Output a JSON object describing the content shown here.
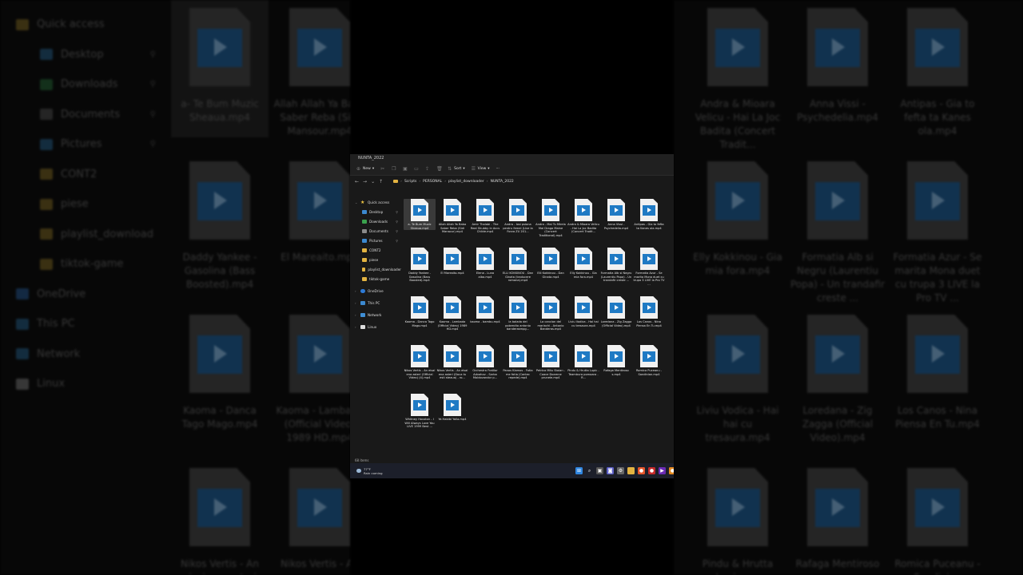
{
  "window": {
    "title": "NUNTA_2022"
  },
  "toolbar": {
    "new_label": "New",
    "sort_label": "Sort",
    "view_label": "View",
    "more_label": "···"
  },
  "address": {
    "crumbs": [
      "Scripts",
      "PERSONAL",
      "playlist_downloader",
      "NUNTA_2022"
    ]
  },
  "nav": {
    "quick_access": "Quick access",
    "items": [
      {
        "label": "Desktop",
        "icon": "desktop-icon"
      },
      {
        "label": "Downloads",
        "icon": "download-icon"
      },
      {
        "label": "Documents",
        "icon": "documents-icon"
      },
      {
        "label": "Pictures",
        "icon": "pictures-icon"
      },
      {
        "label": "CONT2",
        "icon": "folder-icon"
      },
      {
        "label": "piese",
        "icon": "folder-icon"
      },
      {
        "label": "playlist_downloader",
        "icon": "folder-icon"
      },
      {
        "label": "tiktok-game",
        "icon": "folder-icon"
      }
    ],
    "onedrive": "OneDrive",
    "this_pc": "This PC",
    "network": "Network",
    "linux": "Linux"
  },
  "files": [
    "a- Te Bum Muzic Sheaua.mp4",
    "Allah Allah Ya Baba Saber Reba (Sidi Mansour).mp4",
    "Amir Thalabi - The Real Shubby in Accs Childe.mp4",
    "Andra - Iosi psiona pentru femei (Live la Forza ZU 201...",
    "Andra - Mai Tu Mirela Mai Draga Maine (Concert Traditional).mp4",
    "Andra & Mioara Velicu - Hai La Joc Badita (Concert Tradit...",
    "Anna Vissi - Psychedelia.mp4",
    "Antipas - Gia to fefta ta Kanes ola.mp4",
    "Daddy Yankee - Gasolina (Bass Boosted).mp4",
    "El Mareaito.mp4",
    "Elena - Luna alba.mp4",
    "ELLI KOKKINOU - Dan Ginata (traducere romana).mp4",
    "Elli Kokkinou - Dan Ginata.mp4",
    "Elly Kokkinou - Gia mia fora.mp4",
    "Formatia Alb si Negru (Laurentiu Popa) - Un trandafir creste ...",
    "Formatia Azur - Se marita Mona duet cu trupa 3 LIVE la Pro TV ...",
    "Kaoma - Danca Tago Mago.mp4",
    "Kaoma - Lambada (Official Video) 1989 HD.mp4",
    "kaoma - bambu.mp4",
    "la balada del pobrecito antonio banderasmpg...",
    "La cancion del mariachi - Antonio Banderas.mp4",
    "Liviu Vodica - Hai hai cu tresaura.mp4",
    "Loredana - Zig Zagga (Official Video).mp4",
    "Los Canos - Nina Piensa En Tu.mp4",
    "Nikos Vertis - An eisai ena asteri (Official Video) (4).mp4",
    "Nikos Vertis - An eisai ena asteri (Doca tu esti steaua) - ro...",
    "Orchestra Fratilor Advahov - Sarba Moldovandor p...",
    "Panos Kiamos - Fotia me fotia (Cantec repede).mp4",
    "Petrica Mitu Stoian - Coace Doamne prunele.mp4",
    "Pindu & Hrutta Lupic - Teambura pomoara - R...",
    "Rafaga Mentiroso s.mp4",
    "Romica Puceanu - Sandinian.mp4",
    "Whitney Houston - I Will Always Love You LIVE 1999 Best ...",
    "Ya Habibi Yalla.mp4"
  ],
  "status": {
    "count": "68 items"
  },
  "taskbar": {
    "temp": "77°F",
    "condition": "Rain coming"
  },
  "background_left": {
    "nav": [
      "Quick access",
      "Desktop",
      "Downloads",
      "Documents",
      "Pictures",
      "CONT2",
      "piese",
      "playlist_download",
      "tiktok-game",
      "OneDrive",
      "This PC",
      "Network",
      "Linux"
    ],
    "tiles": [
      "a- Te Bum Muzic Sheaua.mp4",
      "Allah Allah Ya Baba Saber Reba (Sidi Mansour.mp4",
      "Daddy Yankee - Gasolina (Bass Boosted).mp4",
      "El Mareaito.mp4",
      "Kaoma - Danca Tago Mago.mp4",
      "Kaoma - Lambada (Official Video) 1989 HD.mp4",
      "Nikos Vertis - An eisai ena asteri",
      "Nikos Vertis - An"
    ]
  },
  "background_right": {
    "tiles": [
      "Andra & Mioara Velicu - Hai La Joc Badita (Concert Tradit...",
      "Anna Vissi - Psychedelia.mp4",
      "Antipas - Gia to fefta ta Kanes ola.mp4",
      "Elly Kokkinou - Gia mia fora.mp4",
      "Formatia Alb si Negru (Laurentiu Popa) - Un trandafir creste ...",
      "Formatia Azur - Se marita Mona duet cu trupa 3 LIVE la Pro TV ...",
      "Liviu Vodica - Hai hai cu tresaura.mp4",
      "Loredana - Zig Zagga (Official Video).mp4",
      "Los Canos - Nina Piensa En Tu.mp4",
      "Pindu & Hrutta Lupic - ...",
      "Rafaga Mentiroso",
      "Romica Puceanu - Sandinian"
    ]
  }
}
